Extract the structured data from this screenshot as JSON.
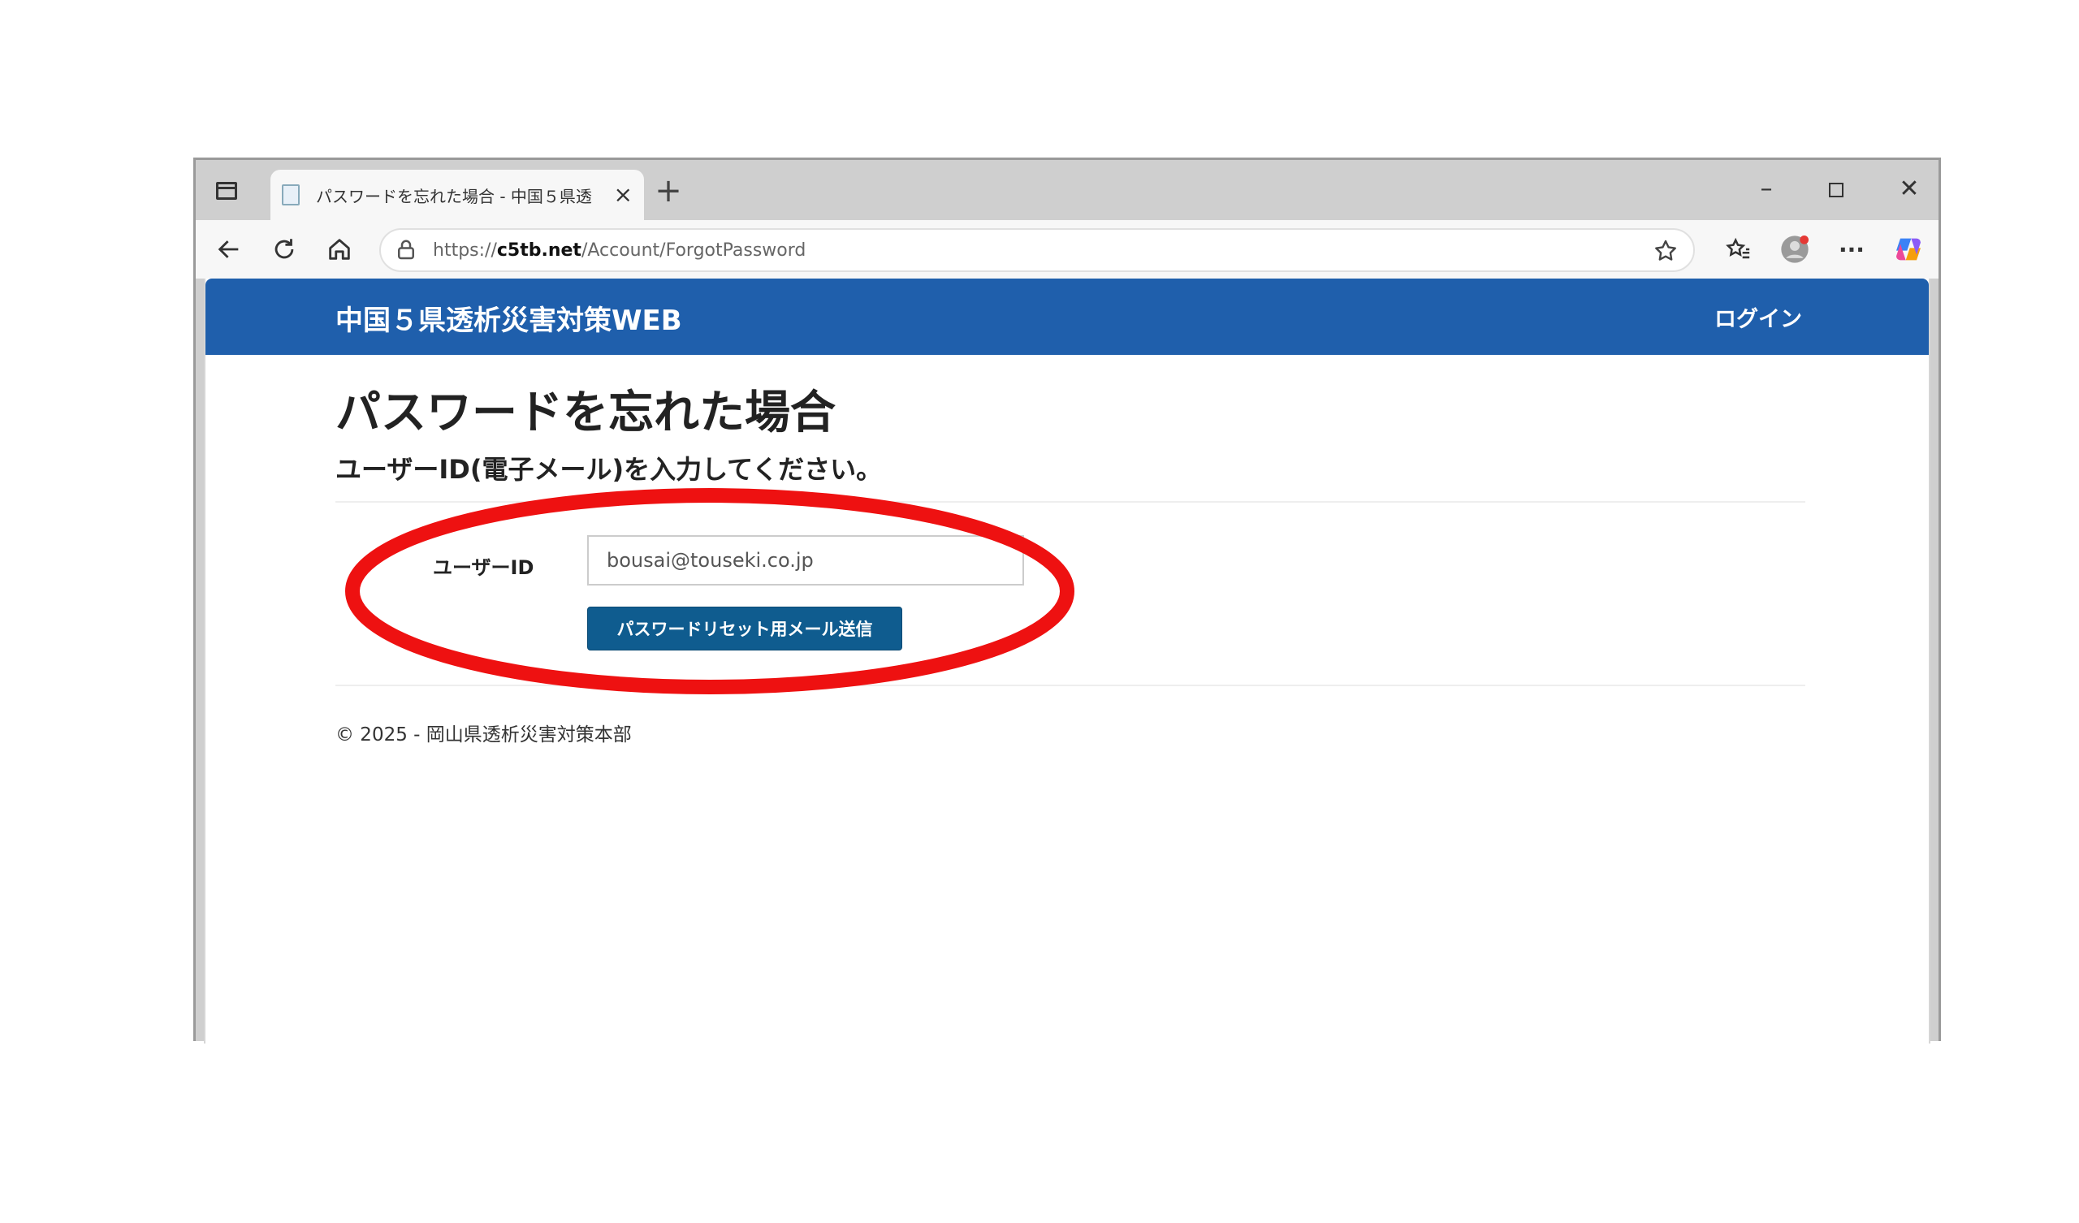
{
  "browser": {
    "tab_title": "パスワードを忘れた場合 - 中国５県透",
    "tab_close": "×",
    "new_tab": "+",
    "url_prefix": "https://",
    "url_host": "c5tb.net",
    "url_path": "/Account/ForgotPassword",
    "window_minimize": "–",
    "window_close": "✕",
    "more_menu": "···"
  },
  "site": {
    "brand": "中国５県透析災害対策WEB",
    "login_link": "ログイン"
  },
  "page": {
    "title": "パスワードを忘れた場合",
    "subtitle": "ユーザーID(電子メール)を入力してください。",
    "user_id_label": "ユーザーID",
    "user_id_value": "bousai@touseki.co.jp",
    "submit_label": "パスワードリセット用メール送信",
    "footer": "© 2025 - 岡山県透析災害対策本部"
  },
  "colors": {
    "header_bg": "#1f5fac",
    "button_bg": "#0f5c8f",
    "highlight": "#ee1111"
  }
}
